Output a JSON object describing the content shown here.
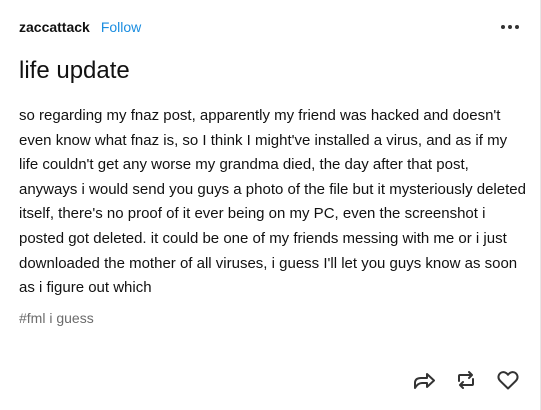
{
  "post": {
    "blog_name": "zaccattack",
    "follow_label": "Follow",
    "more_icon": "ellipsis-icon",
    "title": "life update",
    "body": "so regarding my fnaz post, apparently my friend was hacked and doesn't even know what fnaz is, so I think I might've installed a virus, and as if my life couldn't get any worse my grandma died, the day after that post, anyways i would send you guys a photo of the file but it mysteriously deleted itself, there's no proof of it ever being on my PC, even the screenshot i posted got deleted. it could be one of my friends messing with me or i just downloaded the mother of all viruses, i guess I'll let you guys know as soon as i figure out which",
    "tag": "#fml i guess"
  },
  "actions": [
    {
      "icon": "share-icon"
    },
    {
      "icon": "reblog-icon"
    },
    {
      "icon": "heart-icon"
    }
  ],
  "colors": {
    "accent": "#1a8de0",
    "text": "#111111",
    "tag": "#6b6b6b",
    "icon": "#333333"
  }
}
